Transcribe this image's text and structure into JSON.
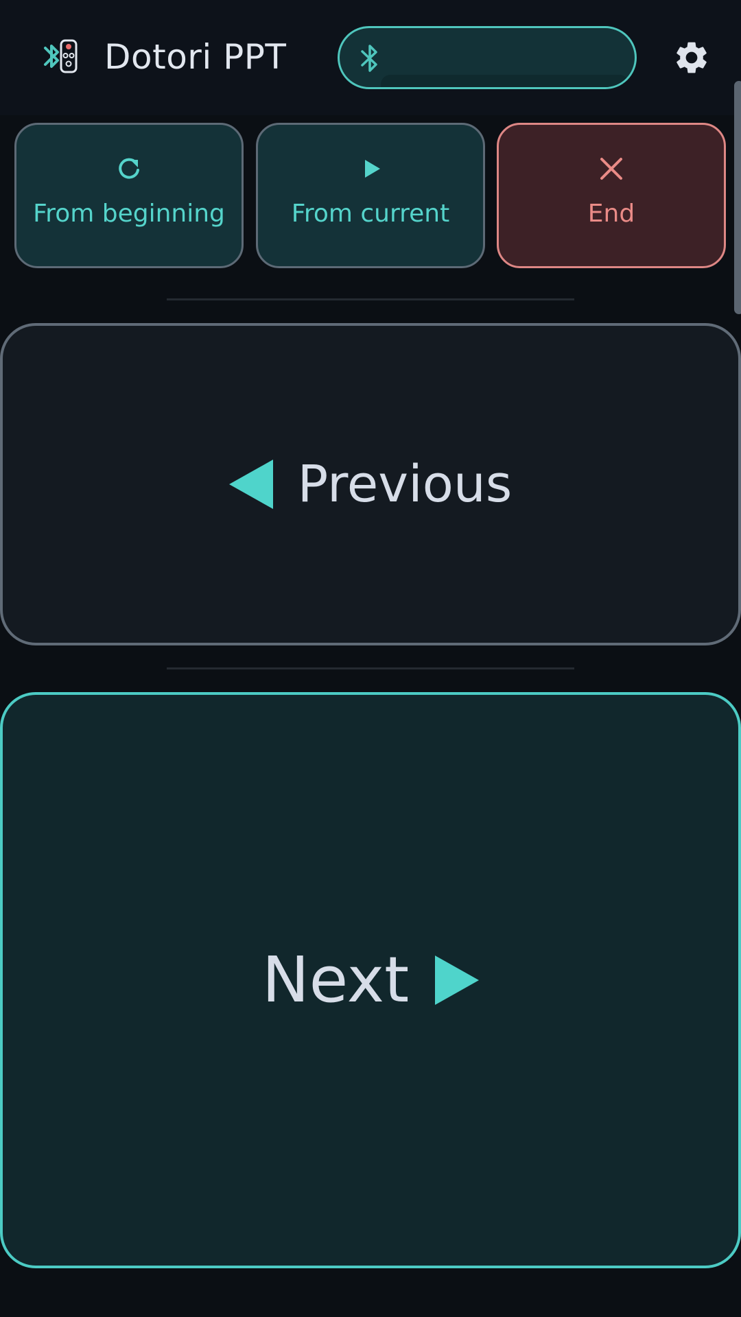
{
  "header": {
    "app_title": "Dotori PPT",
    "bluetooth_status": ""
  },
  "actions": {
    "from_beginning": "From beginning",
    "from_current": "From current",
    "end": "End"
  },
  "navigation": {
    "previous": "Previous",
    "next": "Next"
  },
  "icons": {
    "logo": "bluetooth-remote-logo-icon",
    "bluetooth": "bluetooth-icon",
    "settings": "gear-icon",
    "restart": "refresh-icon",
    "play": "play-icon",
    "close": "close-icon",
    "previous": "triangle-left-icon",
    "next": "triangle-right-icon"
  },
  "colors": {
    "accent": "#4fc6bd",
    "danger": "#ea8b87",
    "background": "#0b0f14",
    "text": "#d7dde8"
  }
}
